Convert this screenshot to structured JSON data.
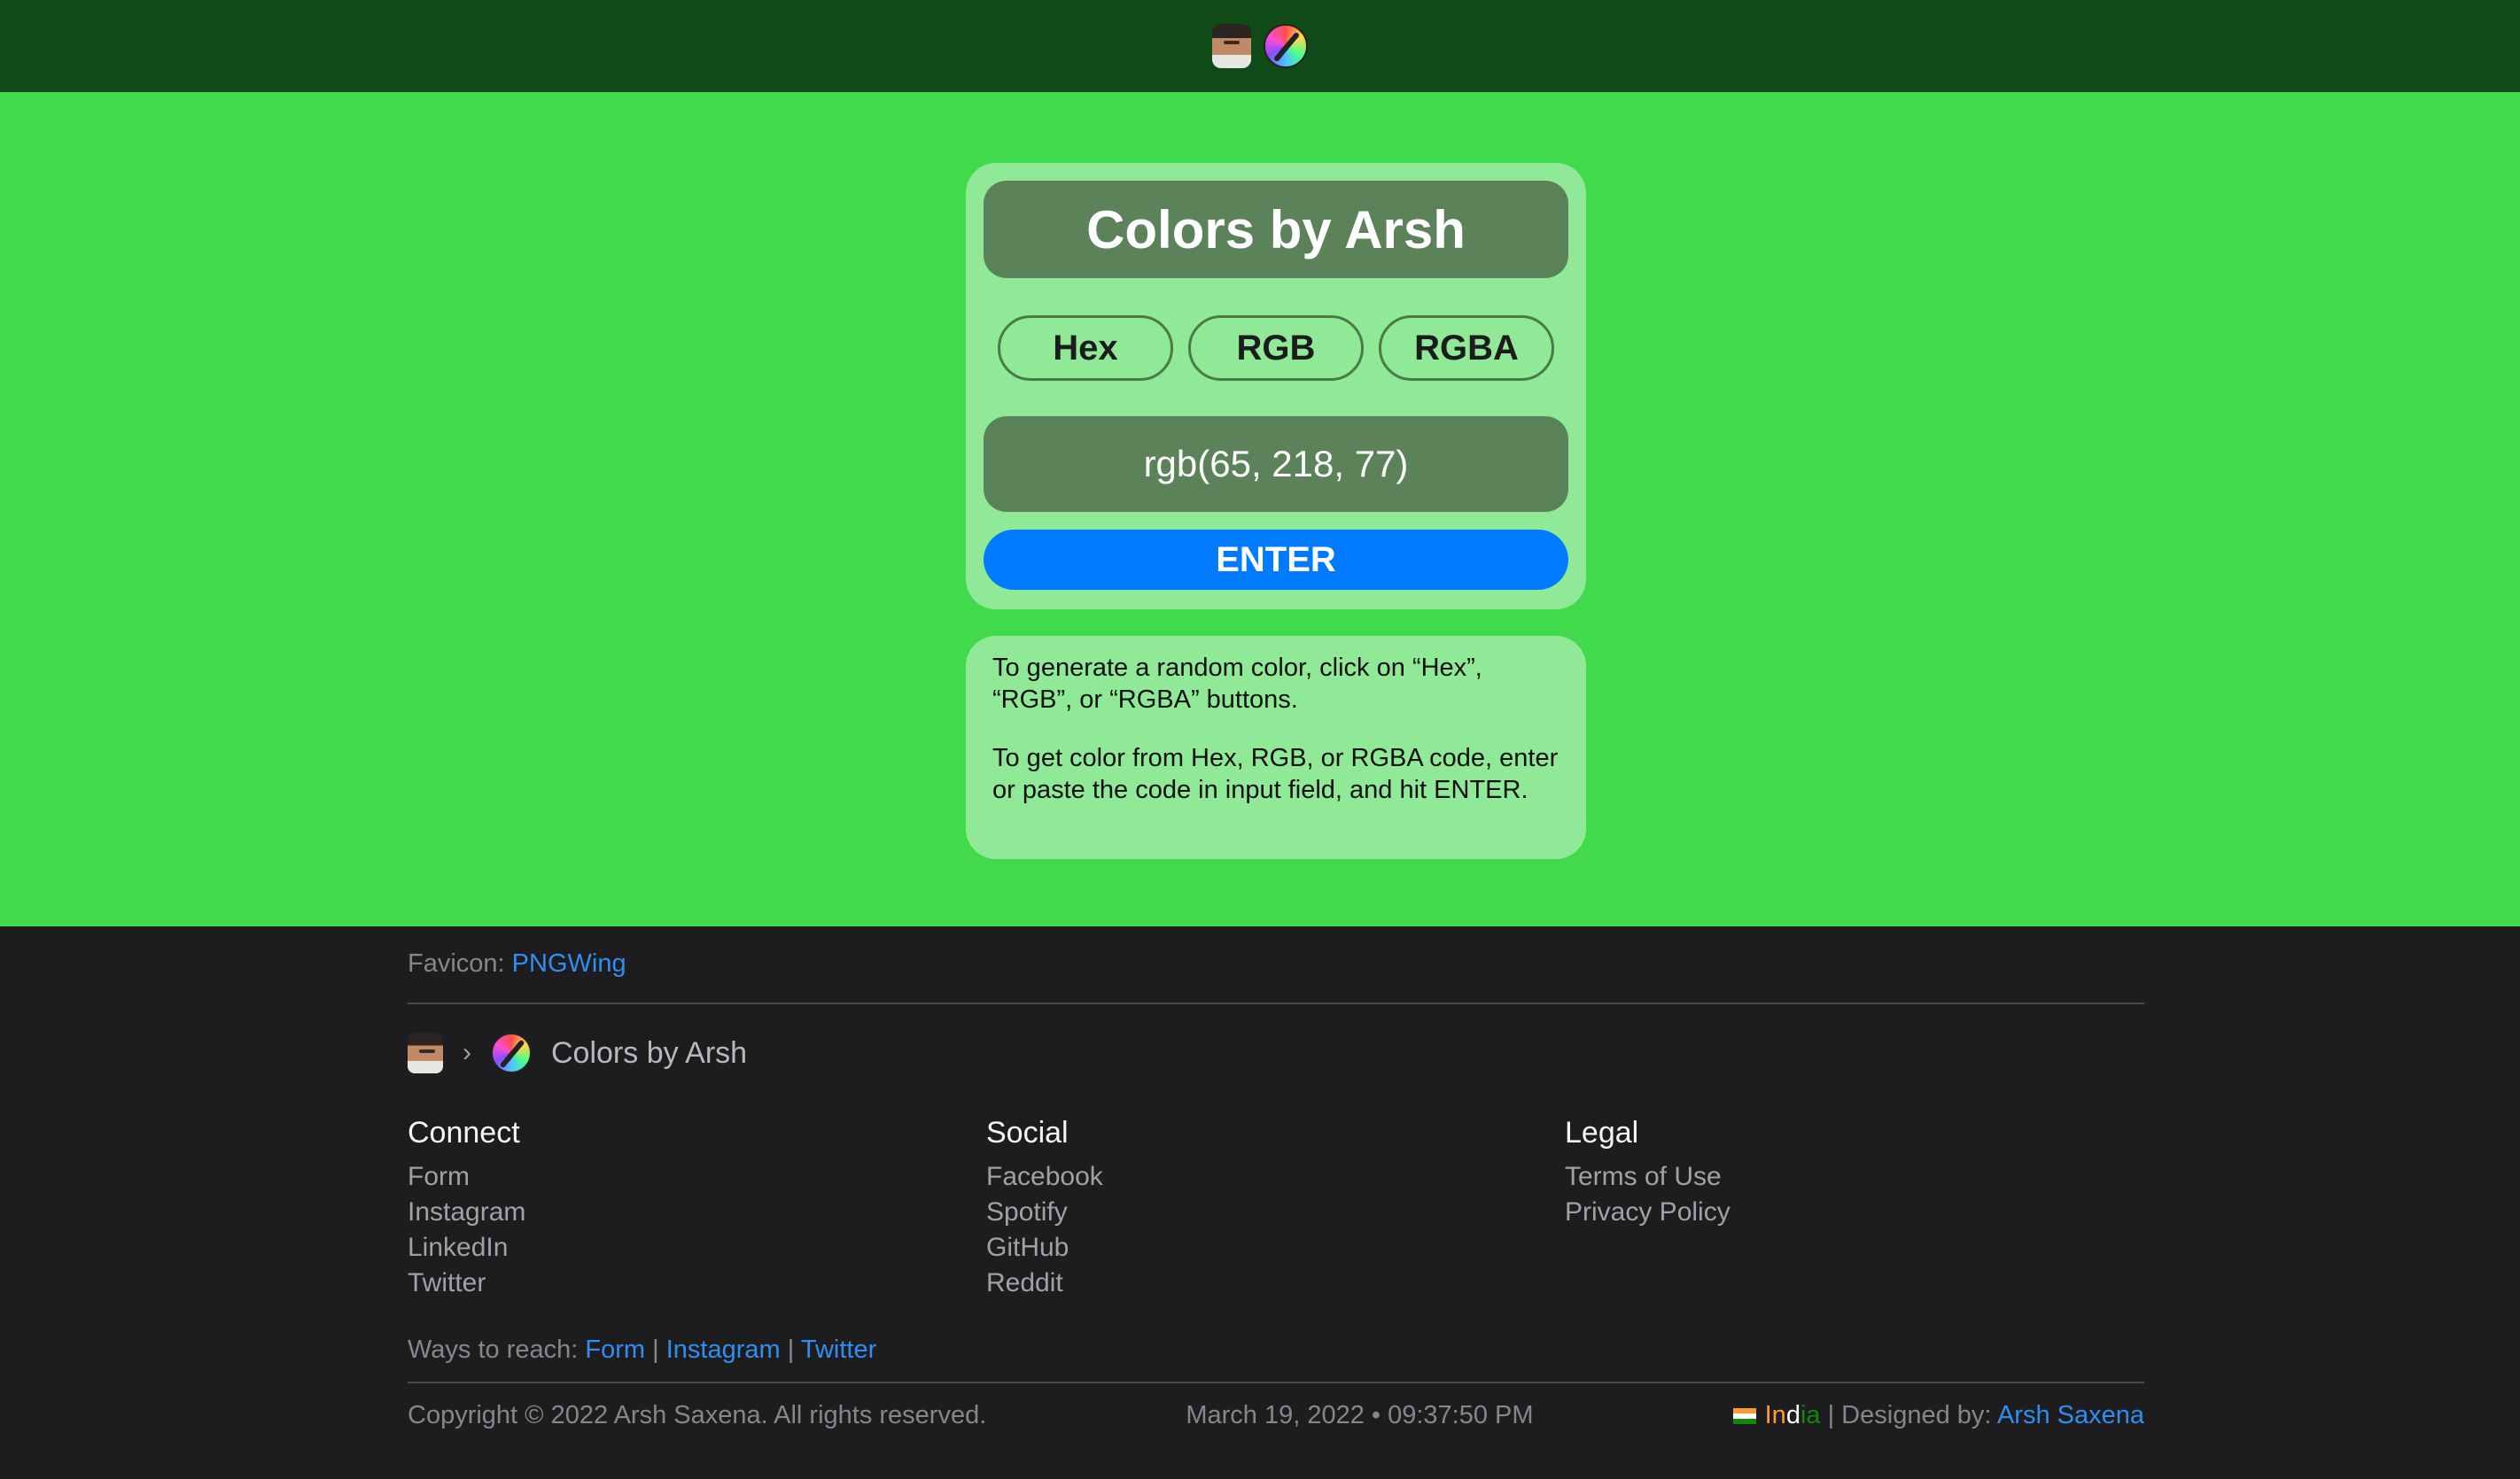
{
  "nav": {
    "avatar_icon": "profile-avatar",
    "logo_icon": "color-wheel-logo"
  },
  "theme": {
    "current_color_hex": "#41da4d"
  },
  "app": {
    "title": "Colors by Arsh",
    "buttons": {
      "hex": "Hex",
      "rgb": "RGB",
      "rgba": "RGBA"
    },
    "input_value": "rgb(65, 218, 77)",
    "enter_label": "ENTER"
  },
  "info": {
    "p1": "To generate a random color, click on “Hex”, “RGB”, or “RGBA” buttons.",
    "p2": "To get color from Hex, RGB, or RGBA code, enter or paste the code in input field, and hit ENTER."
  },
  "footer": {
    "credit_label": "Favicon:",
    "credit_link": "PNGWing",
    "breadcrumb": {
      "separator": "›",
      "current": "Colors by Arsh"
    },
    "columns": [
      {
        "heading": "Connect",
        "links": [
          "Form",
          "Instagram",
          "LinkedIn",
          "Twitter"
        ]
      },
      {
        "heading": "Social",
        "links": [
          "Facebook",
          "Spotify",
          "GitHub",
          "Reddit"
        ]
      },
      {
        "heading": "Legal",
        "links": [
          "Terms of Use",
          "Privacy Policy"
        ]
      }
    ],
    "reach": {
      "label": "Ways to reach:",
      "links": [
        "Form",
        "Instagram",
        "Twitter"
      ],
      "separator": "|"
    },
    "copyright": "Copyright © 2022 Arsh Saxena. All rights reserved.",
    "datetime": "March 19, 2022 • 09:37:50 PM",
    "country": {
      "part1": "In",
      "part2": "d",
      "part3": "ia"
    },
    "designed_label": "| Designed by:",
    "designer": "Arsh Saxena"
  }
}
